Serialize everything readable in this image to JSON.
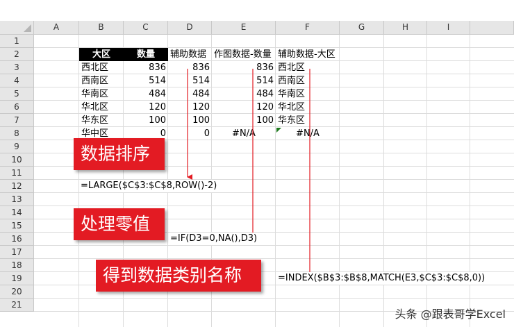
{
  "columns": [
    "A",
    "B",
    "C",
    "D",
    "E",
    "F",
    "G",
    "H",
    "I"
  ],
  "rows": [
    "1",
    "2",
    "3",
    "4",
    "5",
    "6",
    "7",
    "8",
    "9",
    "10",
    "11",
    "12",
    "13",
    "14",
    "15",
    "16",
    "17",
    "18",
    "19",
    "20",
    "21"
  ],
  "table": {
    "headers": {
      "region": "大区",
      "quantity": "数量",
      "helper": "辅助数据",
      "chart_qty": "作图数据-数量",
      "helper_region": "辅助数据-大区"
    },
    "data_rows": [
      {
        "region": "西北区",
        "qty": "836",
        "helper": "836",
        "chart_qty": "836",
        "helper_region": "西北区"
      },
      {
        "region": "西南区",
        "qty": "514",
        "helper": "514",
        "chart_qty": "514",
        "helper_region": "西南区"
      },
      {
        "region": "华南区",
        "qty": "484",
        "helper": "484",
        "chart_qty": "484",
        "helper_region": "华南区"
      },
      {
        "region": "华北区",
        "qty": "120",
        "helper": "120",
        "chart_qty": "120",
        "helper_region": "华北区"
      },
      {
        "region": "华东区",
        "qty": "100",
        "helper": "100",
        "chart_qty": "100",
        "helper_region": "华东区"
      },
      {
        "region": "华中区",
        "qty": "0",
        "helper": "0",
        "chart_qty": "#N/A",
        "helper_region": "#N/A"
      }
    ]
  },
  "callouts": {
    "sort": "数据排序",
    "zero": "处理零值",
    "category": "得到数据类别名称"
  },
  "formulas": {
    "large": "=LARGE($C$3:$C$8,ROW()-2)",
    "if_na": "=IF(D3=0,NA(),D3)",
    "index_match": "=INDEX($B$3:$B$8,MATCH(E3,$C$3:$C$8,0))"
  },
  "watermark": "头条 @跟表哥学Excel",
  "colors": {
    "callout_bg": "#e31b23",
    "arrow": "#e31b23",
    "header_bg": "#000000",
    "error_marker": "#1f7a1f"
  }
}
